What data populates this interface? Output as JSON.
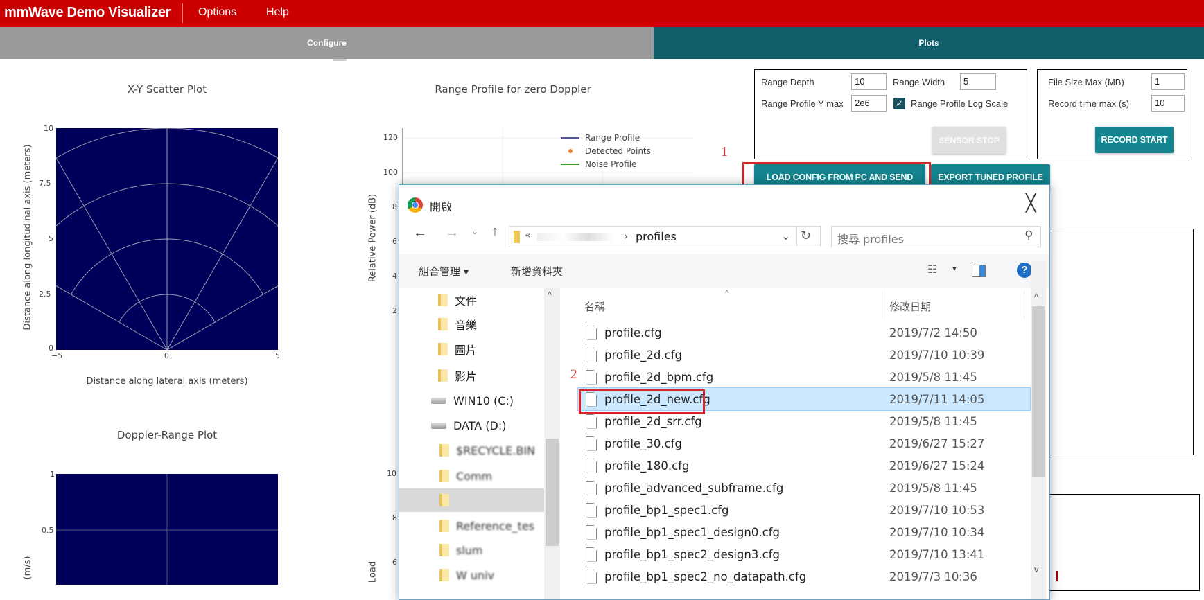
{
  "header": {
    "title": "mmWave Demo Visualizer",
    "menu": [
      "Options",
      "Help"
    ]
  },
  "tabs": [
    {
      "label": "Configure",
      "active": false
    },
    {
      "label": "Plots",
      "active": true
    }
  ],
  "colors": {
    "header": "#cc0000",
    "tab_inactive": "#9a9a9a",
    "tab_active": "#115f6b",
    "button": "#14848f",
    "plot_bg": "#00005a",
    "highlight": "#d9232e"
  },
  "plots": {
    "scatter": {
      "title": "X-Y Scatter Plot",
      "xlabel": "Distance along lateral axis (meters)",
      "ylabel": "Distance along longitudinal axis (meters)",
      "xticks": [
        "−5",
        "0",
        "5"
      ],
      "yticks": [
        "10",
        "7.5",
        "5",
        "2.5",
        "0"
      ]
    },
    "doppler": {
      "title": "Doppler-Range Plot",
      "ylabel": "(m/s)",
      "yticks": [
        "1",
        "0.5"
      ]
    },
    "range": {
      "title": "Range Profile for zero Doppler",
      "ylabel": "Relative Power (dB)",
      "yticks": [
        "120",
        "100",
        "8",
        "6",
        "4",
        "2"
      ],
      "legend": [
        "Range Profile",
        "Detected Points",
        "Noise Profile"
      ]
    },
    "load": {
      "ylabel": "Load",
      "yticks": [
        "10",
        "8",
        "6"
      ]
    }
  },
  "chart_data": [
    {
      "type": "scatter",
      "title": "X-Y Scatter Plot",
      "xlabel": "Distance along lateral axis (meters)",
      "ylabel": "Distance along longitudinal axis (meters)",
      "xlim": [
        -5,
        5
      ],
      "ylim": [
        0,
        10
      ],
      "points": [],
      "grid": "polar"
    },
    {
      "type": "heatmap",
      "title": "Doppler-Range Plot",
      "ylabel": "(m/s)",
      "values": []
    },
    {
      "type": "line",
      "title": "Range Profile for zero Doppler",
      "ylabel": "Relative Power (dB)",
      "series": [
        {
          "name": "Range Profile",
          "values": []
        },
        {
          "name": "Detected Points",
          "values": []
        },
        {
          "name": "Noise Profile",
          "values": []
        }
      ],
      "legend": "top-right"
    }
  ],
  "settings": {
    "range_depth_label": "Range Depth",
    "range_depth": "10",
    "range_width_label": "Range Width",
    "range_width": "5",
    "ymax_label": "Range Profile Y max",
    "ymax": "2e6",
    "logscale_label": "Range Profile Log Scale",
    "logscale": true,
    "sensor_stop": "SENSOR STOP"
  },
  "record": {
    "filesize_label": "File Size Max (MB)",
    "filesize": "1",
    "time_label": "Record time max (s)",
    "time": "10",
    "start": "RECORD START"
  },
  "actions": {
    "load": "LOAD CONFIG FROM PC AND SEND",
    "export": "EXPORT TUNED PROFILE"
  },
  "annotations": {
    "step1": "1",
    "step2": "2"
  },
  "dialog": {
    "title": "開啟",
    "path_prefix": "«",
    "path_current": "profiles",
    "search_placeholder": "搜尋 profiles",
    "organize": "組合管理 ▾",
    "new_folder": "新增資料夾",
    "nav": [
      {
        "label": "文件",
        "type": "docs"
      },
      {
        "label": "音樂",
        "type": "music"
      },
      {
        "label": "圖片",
        "type": "pictures"
      },
      {
        "label": "影片",
        "type": "videos"
      },
      {
        "label": "WIN10 (C:)",
        "type": "drive"
      },
      {
        "label": "DATA (D:)",
        "type": "drive"
      },
      {
        "label": "$RECYCLE.BIN",
        "type": "folder"
      },
      {
        "label": "Comm",
        "type": "folder"
      },
      {
        "label": "",
        "type": "folder",
        "selected": true
      },
      {
        "label": "Reference_tes",
        "type": "folder"
      },
      {
        "label": "slum",
        "type": "folder"
      },
      {
        "label": "W univ",
        "type": "folder"
      }
    ],
    "columns": {
      "name": "名稱",
      "modified": "修改日期"
    },
    "files": [
      {
        "name": "profile.cfg",
        "date": "2019/7/2 14:50"
      },
      {
        "name": "profile_2d.cfg",
        "date": "2019/7/10 10:39"
      },
      {
        "name": "profile_2d_bpm.cfg",
        "date": "2019/5/8 11:45"
      },
      {
        "name": "profile_2d_new.cfg",
        "date": "2019/7/11 14:05",
        "selected": true
      },
      {
        "name": "profile_2d_srr.cfg",
        "date": "2019/5/8 11:45"
      },
      {
        "name": "profile_30.cfg",
        "date": "2019/6/27 15:27"
      },
      {
        "name": "profile_180.cfg",
        "date": "2019/6/27 15:24"
      },
      {
        "name": "profile_advanced_subframe.cfg",
        "date": "2019/5/8 11:45"
      },
      {
        "name": "profile_bp1_spec1.cfg",
        "date": "2019/7/10 10:53"
      },
      {
        "name": "profile_bp1_spec1_design0.cfg",
        "date": "2019/7/10 10:34"
      },
      {
        "name": "profile_bp1_spec2_design3.cfg",
        "date": "2019/7/10 13:41"
      },
      {
        "name": "profile_bp1_spec2_no_datapath.cfg",
        "date": "2019/7/3 10:36"
      }
    ]
  }
}
